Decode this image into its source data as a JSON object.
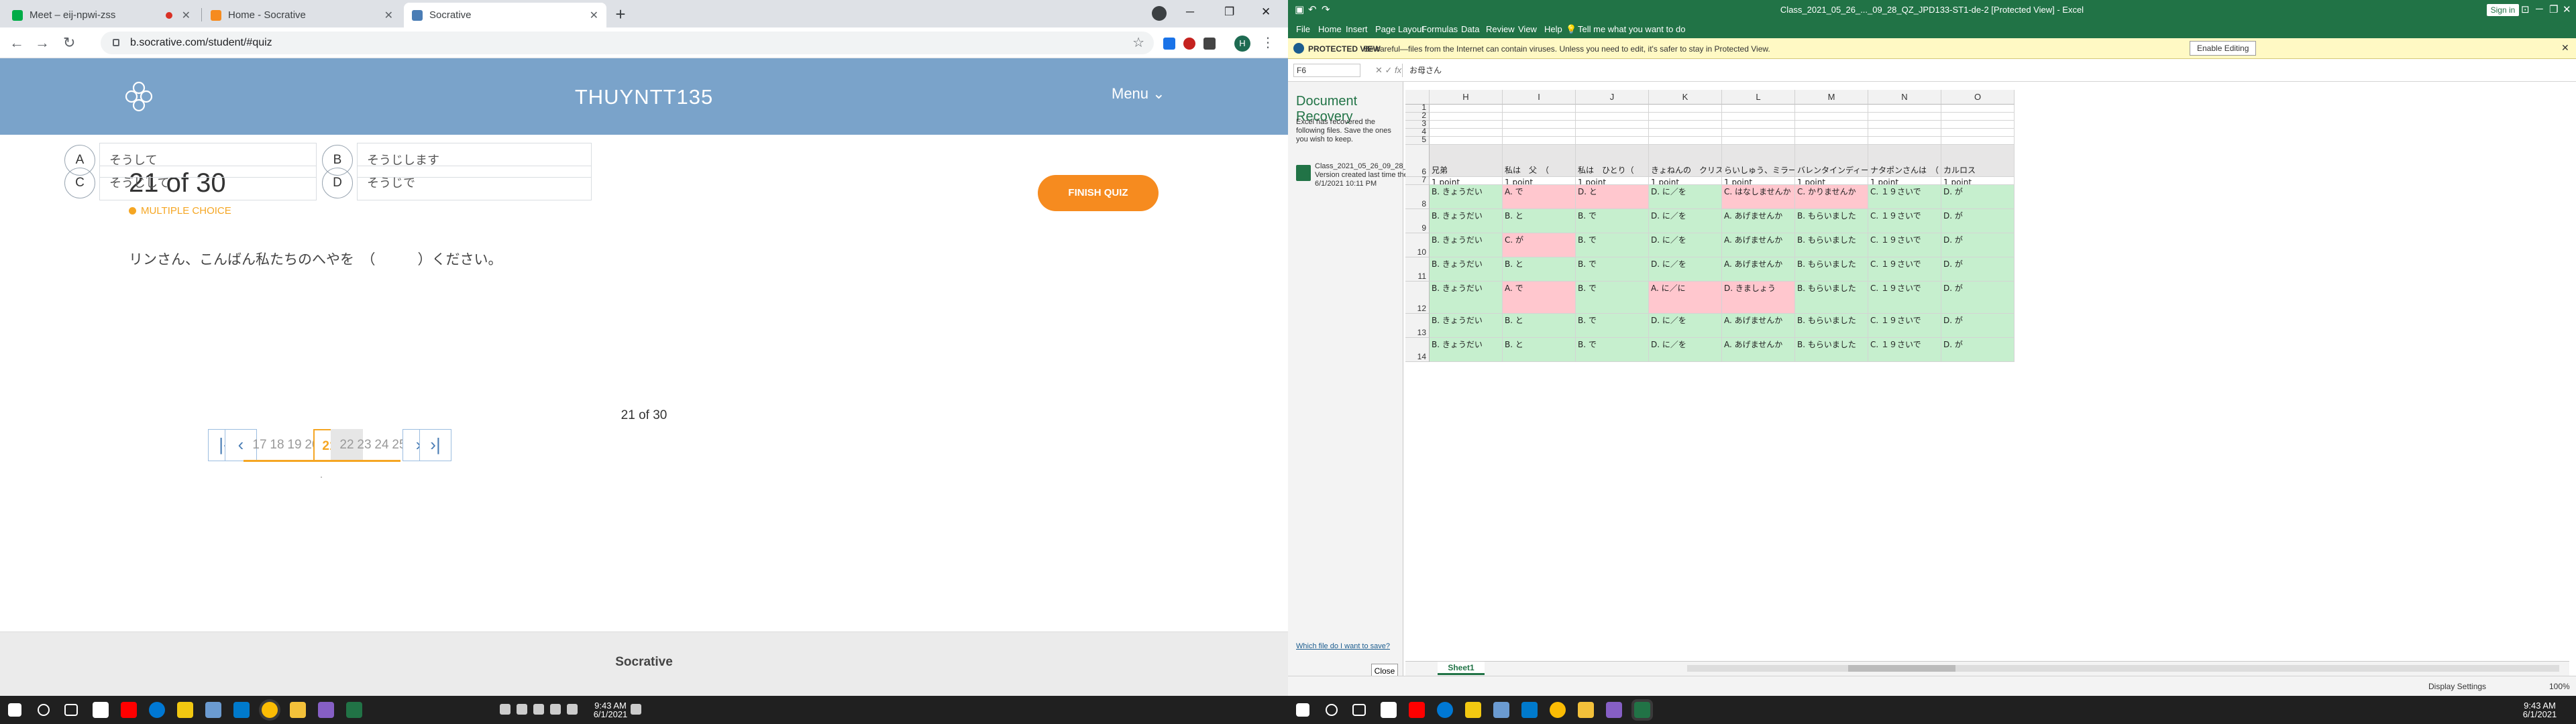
{
  "left": {
    "tabs": [
      {
        "title": "Meet – eij-npwi-zss",
        "color": "#00ac47"
      },
      {
        "title": "Home - Socrative",
        "color": "#f68b1f"
      },
      {
        "title": "Socrative",
        "color": "#4a7db5"
      }
    ],
    "url": "b.socrative.com/student/#quiz",
    "profile_initial": "H",
    "socrative": {
      "room_name": "THUYNTT135",
      "menu_label": "Menu ⌄",
      "question_number": "21 of 30",
      "question_type": "MULTIPLE CHOICE",
      "finish_label": "FINISH QUIZ",
      "question_text": "リンさん、こんばん私たちのへやを　（　　　）ください。",
      "answers": [
        {
          "letter": "A",
          "text": "そうして"
        },
        {
          "letter": "B",
          "text": "そうじします"
        },
        {
          "letter": "C",
          "text": "そうじして"
        },
        {
          "letter": "D",
          "text": "そうじで"
        }
      ],
      "pager_label": "21 of 30",
      "pager_numbers": [
        "17",
        "18",
        "19",
        "20",
        "21",
        "22",
        "23",
        "24",
        "25"
      ],
      "pager_current": "21",
      "pager_dot": "·",
      "footer": "Socrative"
    },
    "taskbar_time": "9:43 AM",
    "taskbar_date": "6/1/2021"
  },
  "right": {
    "title": "Class_2021_05_26_..._09_28_QZ_JPD133-ST1-de-2 [Protected View] - Excel",
    "signin": "Sign in",
    "menu": [
      "File",
      "Home",
      "Insert",
      "Page Layout",
      "Formulas",
      "Data",
      "Review",
      "View",
      "Help",
      "Tell me what you want to do"
    ],
    "protected_label": "PROTECTED VIEW",
    "protected_text": "Be careful—files from the Internet can contain viruses. Unless you need to edit, it's safer to stay in Protected View.",
    "enable_label": "Enable Editing",
    "name_box": "F6",
    "formula": "お母さん",
    "recovery": {
      "title": "Document Recovery",
      "desc": "Excel has recovered the following files. Save the ones you wish to keep.",
      "file_name": "Class_2021_05_26_09_28_Q...",
      "file_note": "Version created last time the...",
      "file_date": "6/1/2021 10:11 PM",
      "which_link": "Which file do I want to save?",
      "close_label": "Close"
    },
    "columns": [
      "H",
      "I",
      "J",
      "K",
      "L",
      "M",
      "N",
      "O"
    ],
    "row_numbers": [
      "1",
      "2",
      "3",
      "4",
      "5",
      "6",
      "7",
      "8",
      "9",
      "10",
      "11",
      "12",
      "13",
      "14"
    ],
    "header_row": [
      "兄弟",
      "私は　父　（　　　　）",
      "私は　ひとり（　　　）",
      "きょねんの　クリスマスに",
      "らいしゅう、ミラーさんの",
      "バレンタインディーに　こ",
      "ナタポンさんは　（",
      "カルロス"
    ],
    "points_row": [
      "1 point",
      "1 point",
      "1 point",
      "1 point",
      "1 point",
      "1 point",
      "1 point",
      "1 point"
    ],
    "data_rows": [
      [
        "B. きょうだい",
        "A. で",
        "D. と",
        "D. に／を",
        "C. はなしませんか",
        "C. かりませんか",
        "C. １９さいで",
        "D. が"
      ],
      [
        "B. きょうだい",
        "B. と",
        "B. で",
        "D. に／を",
        "A. あげませんか",
        "B. もらいました",
        "C. １９さいで",
        "D. が"
      ],
      [
        "B. きょうだい",
        "C. が",
        "B. で",
        "D. に／を",
        "A. あげませんか",
        "B. もらいました",
        "C. １９さいで",
        "D. が"
      ],
      [
        "B. きょうだい",
        "B. と",
        "B. で",
        "D. に／を",
        "A. あげませんか",
        "B. もらいました",
        "C. １９さいで",
        "D. が"
      ],
      [
        "B. きょうだい",
        "A. で",
        "B. で",
        "A. に／に",
        "D. きましょう",
        "B. もらいました",
        "C. １９さいで",
        "D. が"
      ],
      [
        "B. きょうだい",
        "B. と",
        "B. で",
        "D. に／を",
        "A. あげませんか",
        "B. もらいました",
        "C. １９さいで",
        "D. が"
      ],
      [
        "B. きょうだい",
        "B. と",
        "B. で",
        "D. に／を",
        "A. あげませんか",
        "B. もらいました",
        "C. １９さいで",
        "D. が"
      ]
    ],
    "data_fill": [
      [
        "g",
        "r",
        "r",
        "g",
        "r",
        "r",
        "g",
        "g"
      ],
      [
        "g",
        "g",
        "g",
        "g",
        "g",
        "g",
        "g",
        "g"
      ],
      [
        "g",
        "r",
        "g",
        "g",
        "g",
        "g",
        "g",
        "g"
      ],
      [
        "g",
        "g",
        "g",
        "g",
        "g",
        "g",
        "g",
        "g"
      ],
      [
        "g",
        "r",
        "g",
        "r",
        "r",
        "g",
        "g",
        "g"
      ],
      [
        "g",
        "g",
        "g",
        "g",
        "g",
        "g",
        "g",
        "g"
      ],
      [
        "g",
        "g",
        "g",
        "g",
        "g",
        "g",
        "g",
        "g"
      ]
    ],
    "sheet_tab": "Sheet1",
    "status_display": "Display Settings",
    "zoom": "100%",
    "taskbar_time": "9:43 AM",
    "taskbar_date": "6/1/2021"
  }
}
